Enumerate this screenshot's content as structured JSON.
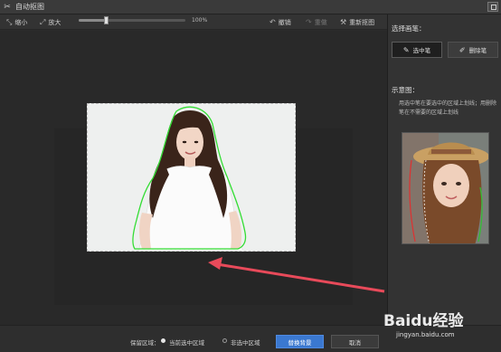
{
  "window": {
    "title": "自动抠图"
  },
  "toolbar": {
    "shrink_label": "缩小",
    "enlarge_label": "放大",
    "zoom_percent": 100,
    "zoom_label": "100%",
    "undo_label": "撤销",
    "redo_label": "重做",
    "reset_label": "重新抠图"
  },
  "panel": {
    "choose_pen_label": "选择画笔：",
    "select_pen_label": "选中笔",
    "erase_pen_label": "删除笔",
    "example_label": "示意图：",
    "hint_text": "用选中笔在要选中的区域上划线；用删除笔在不需要的区域上划线"
  },
  "bottom": {
    "keep_area_label": "保留区域：",
    "option_current": "当前选中区域",
    "option_inverse": "非选中区域",
    "selected_option": "当前选中区域",
    "replace_bg_label": "替换背景",
    "cancel_label": "取消"
  },
  "watermark": {
    "brand": "Baidu经验",
    "url": "jingyan.baidu.com"
  },
  "colors": {
    "accent_button": "#3a78d0",
    "selection_outline": "#33dd33",
    "arrow": "#e84a5a"
  },
  "icons": {
    "title": "scissors-icon",
    "shrink": "shrink-icon",
    "enlarge": "enlarge-icon",
    "undo": "undo-icon",
    "redo": "redo-icon",
    "reset": "magic-wand-icon",
    "select_pen": "pen-icon",
    "erase_pen": "eraser-icon"
  }
}
